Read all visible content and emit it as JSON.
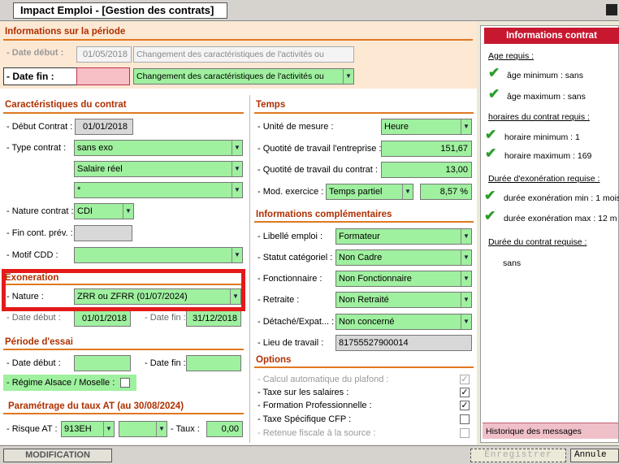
{
  "title": "Impact Emploi - [Gestion des contrats]",
  "periode": {
    "header": "Informations sur la période",
    "date_debut_label": "- Date début :",
    "date_debut": "01/05/2018",
    "motif_debut": "Changement des caractéristiques de l'activités ou",
    "date_fin_label": "- Date fin :",
    "date_fin": "",
    "motif_fin": "Changement des caractéristiques de l'activités ou"
  },
  "contrat": {
    "header": "Caractéristiques du contrat",
    "debut_label": "- Début Contrat :",
    "debut": "01/01/2018",
    "type_label": "- Type contrat :",
    "type": "sans exo",
    "type2": "Salaire réel",
    "type3": "*",
    "nature_label": "- Nature contrat :",
    "nature": "CDI",
    "fin_prev_label": "- Fin cont. prév. :",
    "motif_cdd_label": "- Motif CDD :"
  },
  "exoneration": {
    "header": "Exoneration",
    "nature_label": "- Nature :",
    "nature": "ZRR ou ZFRR (01/07/2024)",
    "date_debut_label": "- Date début :",
    "date_debut": "01/01/2018",
    "date_fin_label": "- Date fin :",
    "date_fin": "31/12/2018"
  },
  "essai": {
    "header": "Période d'essai",
    "date_debut_label": "- Date début :",
    "date_fin_label": "- Date fin :",
    "alsace_label": "- Régime Alsace / Moselle :"
  },
  "taux_at": {
    "header": "Paramétrage du taux AT (au 30/08/2024)",
    "risque_label": "- Risque AT :",
    "risque": "913EH",
    "taux_label": "- Taux :",
    "taux": "0,00"
  },
  "temps": {
    "header": "Temps",
    "unite_label": "- Unité de mesure :",
    "unite": "Heure",
    "quotite_ent_label": "- Quotité de travail l'entreprise :",
    "quotite_ent": "151,67",
    "quotite_contrat_label": "- Quotité de travail du contrat :",
    "quotite_contrat": "13,00",
    "mod_label": "- Mod. exercice :",
    "mod": "Temps partiel",
    "mod_pct": "8,57 %"
  },
  "complementaires": {
    "header": "Informations complémentaires",
    "libelle_label": "- Libellé emploi :",
    "libelle": "Formateur",
    "statut_label": "- Statut catégoriel :",
    "statut": "Non Cadre",
    "fonctionnaire_label": "- Fonctionnaire :",
    "fonctionnaire": "Non Fonctionnaire",
    "retraite_label": "- Retraite :",
    "retraite": "Non Retraité",
    "detache_label": "- Détaché/Expat... :",
    "detache": "Non concerné",
    "lieu_label": "- Lieu de travail :",
    "lieu": "81755527900014"
  },
  "options": {
    "header": "Options",
    "items": [
      {
        "label": "- Calcul automatique du plafond :",
        "mark": "✓"
      },
      {
        "label": "- Taxe sur les salaires :",
        "mark": "✓"
      },
      {
        "label": "- Formation Professionnelle :",
        "mark": "✓"
      },
      {
        "label": "- Taxe Spécifique CFP :",
        "mark": ""
      },
      {
        "label": "- Retenue fiscale à la source :",
        "mark": ""
      }
    ]
  },
  "panel": {
    "title": "Informations contrat",
    "age_header": "Age requis :",
    "age_min": "âge minimum :  sans",
    "age_max": "âge maximum :  sans",
    "horaires_header": "horaires du contrat requis :",
    "horaire_min": "horaire minimum : 1",
    "horaire_max": "horaire maximum : 169",
    "duree_exo_header": "Durée d'exonération requise :",
    "exo_min": "durée exonération min : 1 mois",
    "exo_max": "durée exonération max : 12 m",
    "duree_contrat_header": "Durée du contrat requise :",
    "duree_contrat": "sans",
    "historique": "Historique des messages"
  },
  "status": {
    "mode": "MODIFICATION",
    "enregistrer": "Enregistrer",
    "annuler": "Annule"
  },
  "colors": {
    "accent": "#e07820",
    "field_green": "#9ff09f",
    "panel_red": "#c81830",
    "highlight_red": "#e41a1a"
  }
}
